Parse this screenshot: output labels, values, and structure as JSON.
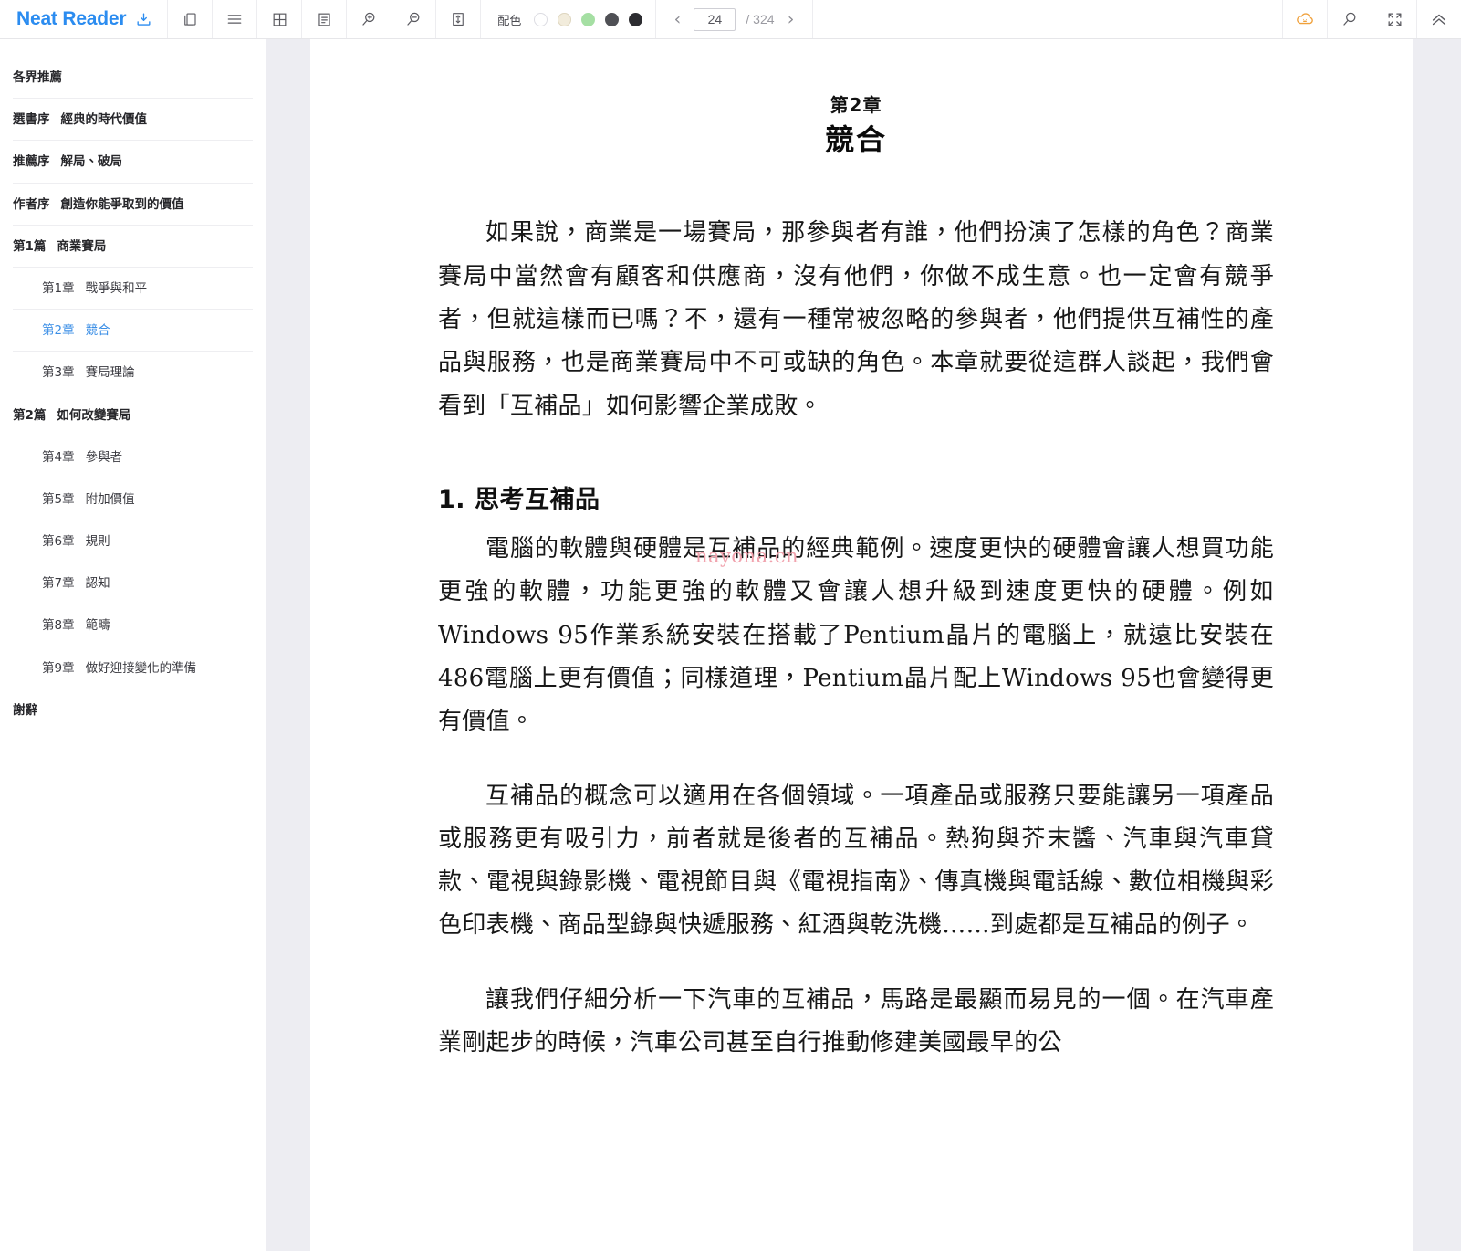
{
  "app": {
    "brand": "Neat Reader",
    "brand_icon": "save-to-bookshelf-icon"
  },
  "toolbar": {
    "buttons": [
      {
        "name": "library-icon",
        "label": "書庫"
      },
      {
        "name": "contents-list-icon",
        "label": "目錄"
      },
      {
        "name": "grid-layout-icon",
        "label": "版面"
      },
      {
        "name": "notes-icon",
        "label": "筆記"
      },
      {
        "name": "zoom-in-icon",
        "label": "放大"
      },
      {
        "name": "zoom-out-icon",
        "label": "縮小"
      },
      {
        "name": "line-height-icon",
        "label": "行距"
      }
    ],
    "theme": {
      "label": "配色",
      "swatches": [
        {
          "name": "theme-white",
          "color": "#ffffff",
          "border": "#dcdce2",
          "selected": false
        },
        {
          "name": "theme-sepia",
          "color": "#f2ecdc",
          "border": "#ded6c0",
          "selected": false
        },
        {
          "name": "theme-green",
          "color": "#a5dfa3",
          "border": "#a5dfa3",
          "selected": false
        },
        {
          "name": "theme-gray",
          "color": "#4f5055",
          "border": "#4f5055",
          "selected": false
        },
        {
          "name": "theme-black",
          "color": "#2c2c30",
          "border": "#2c2c30",
          "selected": false
        }
      ]
    },
    "pager": {
      "prev": "‹",
      "next": "›",
      "current_page": "24",
      "total_label": "/ 324",
      "total_pages": 324
    },
    "right_buttons": [
      {
        "name": "cloud-sync-icon",
        "label": "雲端同步",
        "color": "#f0a13c"
      },
      {
        "name": "search-icon",
        "label": "搜尋",
        "color": "#5a5a60"
      },
      {
        "name": "fullscreen-icon",
        "label": "全螢幕",
        "color": "#5a5a60"
      },
      {
        "name": "collapse-up-icon",
        "label": "收合",
        "color": "#5a5a60"
      }
    ]
  },
  "sidebar": {
    "items": [
      {
        "level": 1,
        "num": "",
        "label": "各界推薦",
        "active": false
      },
      {
        "level": 1,
        "num": "選書序",
        "label": "經典的時代價值",
        "active": false
      },
      {
        "level": 1,
        "num": "推薦序",
        "label": "解局、破局",
        "active": false
      },
      {
        "level": 1,
        "num": "作者序",
        "label": "創造你能爭取到的價值",
        "active": false
      },
      {
        "level": 1,
        "num": "第1篇",
        "label": "商業賽局",
        "active": false
      },
      {
        "level": 2,
        "num": "第1章",
        "label": "戰爭與和平",
        "active": false
      },
      {
        "level": 2,
        "num": "第2章",
        "label": "競合",
        "active": true
      },
      {
        "level": 2,
        "num": "第3章",
        "label": "賽局理論",
        "active": false
      },
      {
        "level": 1,
        "num": "第2篇",
        "label": "如何改變賽局",
        "active": false
      },
      {
        "level": 2,
        "num": "第4章",
        "label": "參與者",
        "active": false
      },
      {
        "level": 2,
        "num": "第5章",
        "label": "附加價值",
        "active": false
      },
      {
        "level": 2,
        "num": "第6章",
        "label": "規則",
        "active": false
      },
      {
        "level": 2,
        "num": "第7章",
        "label": "認知",
        "active": false
      },
      {
        "level": 2,
        "num": "第8章",
        "label": "範疇",
        "active": false
      },
      {
        "level": 2,
        "num": "第9章",
        "label": "做好迎接變化的準備",
        "active": false
      },
      {
        "level": 1,
        "num": "",
        "label": "謝辭",
        "active": false
      }
    ]
  },
  "content": {
    "chapter_label": "第2章",
    "chapter_title": "競合",
    "paragraph_intro": "如果說，商業是一場賽局，那參與者有誰，他們扮演了怎樣的角色？商業賽局中當然會有顧客和供應商，沒有他們，你做不成生意。也一定會有競爭者，但就這樣而已嗎？不，還有一種常被忽略的參與者，他們提供互補性的產品與服務，也是商業賽局中不可或缺的角色。本章就要從這群人談起，我們會看到「互補品」如何影響企業成敗。",
    "section_heading": "1. 思考互補品",
    "watermark": "nayona.cn",
    "paragraph_1": "電腦的軟體與硬體是互補品的經典範例。速度更快的硬體會讓人想買功能更強的軟體，功能更強的軟體又會讓人想升級到速度更快的硬體。例如Windows 95作業系統安裝在搭載了Pentium晶片的電腦上，就遠比安裝在486電腦上更有價值；同樣道理，Pentium晶片配上Windows 95也會變得更有價值。",
    "paragraph_2": "互補品的概念可以適用在各個領域。一項產品或服務只要能讓另一項產品或服務更有吸引力，前者就是後者的互補品。熱狗與芥末醬、汽車與汽車貸款、電視與錄影機、電視節目與《電視指南》、傳真機與電話線、數位相機與彩色印表機、商品型錄與快遞服務、紅酒與乾洗機……到處都是互補品的例子。",
    "paragraph_3": "讓我們仔細分析一下汽車的互補品，馬路是最顯而易見的一個。在汽車產業剛起步的時候，汽車公司甚至自行推動修建美國最早的公"
  }
}
